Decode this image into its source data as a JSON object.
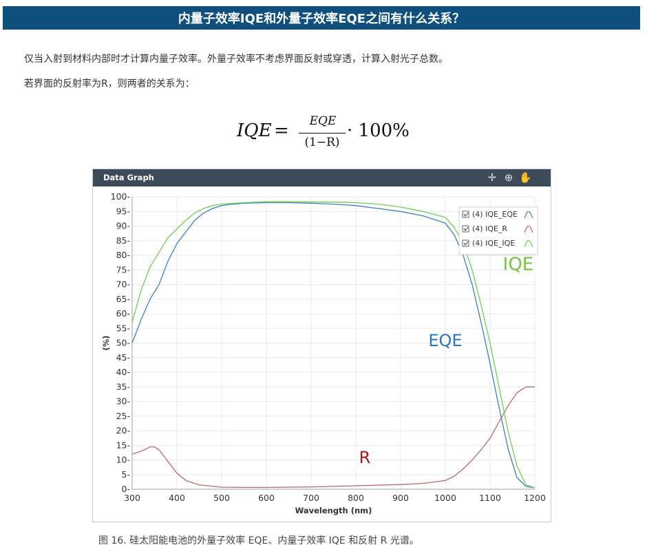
{
  "header": {
    "title": "内量子效率IQE和外量子效率EQE之间有什么关系？"
  },
  "body": {
    "paragraph1": "仅当入射到材料内部时才计算内量子效率。外量子效率不考虑界面反射或穿透，计算入射光子总数。",
    "paragraph2": "若界面的反射率为R，则两者的关系为："
  },
  "formula": {
    "lhs": "IQE",
    "equals": "=",
    "numerator": "EQE",
    "denominator": "(1−R)",
    "rhs": "· 100%"
  },
  "graph": {
    "title": "Data Graph",
    "tools": [
      {
        "name": "crosshair-icon",
        "glyph": "✛"
      },
      {
        "name": "zoom-icon",
        "glyph": "⊕"
      },
      {
        "name": "pan-hand-icon",
        "glyph": "✋"
      }
    ]
  },
  "chart_data": {
    "type": "line",
    "xlabel": "Wavelength (nm)",
    "ylabel": "(%)",
    "xlim": [
      300,
      1200
    ],
    "ylim": [
      0,
      100
    ],
    "xticks": [
      300,
      400,
      500,
      600,
      700,
      800,
      900,
      1000,
      1100,
      1200
    ],
    "yticks": [
      0,
      5,
      10,
      15,
      20,
      25,
      30,
      35,
      40,
      45,
      50,
      55,
      60,
      65,
      70,
      75,
      80,
      85,
      90,
      95,
      100
    ],
    "grid": true,
    "legend_position": "top-right",
    "series": [
      {
        "name": "(4) IQE_EQE",
        "color": "#3f7fba",
        "label": "EQE",
        "label_color": "#2a73c0",
        "x": [
          300,
          320,
          340,
          360,
          380,
          400,
          420,
          440,
          460,
          480,
          500,
          520,
          550,
          600,
          650,
          700,
          750,
          800,
          850,
          900,
          950,
          1000,
          1020,
          1040,
          1060,
          1080,
          1100,
          1120,
          1140,
          1160,
          1180,
          1200
        ],
        "y": [
          50,
          58,
          65,
          70,
          78,
          84,
          88,
          92,
          94.5,
          96,
          97,
          97.4,
          97.8,
          98,
          98,
          97.8,
          97.5,
          97,
          96,
          95,
          93.5,
          91,
          87,
          80,
          70,
          57,
          43,
          28,
          14,
          4,
          1,
          0.5
        ]
      },
      {
        "name": "(4) IQE_R",
        "color": "#b5696a",
        "label": "R",
        "label_color": "#b01818",
        "x": [
          300,
          320,
          340,
          350,
          360,
          380,
          400,
          420,
          450,
          500,
          550,
          600,
          700,
          800,
          900,
          950,
          1000,
          1020,
          1040,
          1060,
          1080,
          1100,
          1120,
          1140,
          1160,
          1180,
          1200
        ],
        "y": [
          12,
          13,
          14.5,
          14.5,
          13.5,
          9.5,
          5.5,
          3,
          1.5,
          0.7,
          0.6,
          0.6,
          0.8,
          1.2,
          1.6,
          2,
          3,
          4.5,
          7,
          10,
          13.5,
          17.5,
          23,
          28.5,
          33,
          35,
          35
        ]
      },
      {
        "name": "(4) IQE_IQE",
        "color": "#6ccf52",
        "label": "IQE",
        "label_color": "#73c43f",
        "x": [
          300,
          320,
          340,
          360,
          380,
          400,
          420,
          440,
          460,
          480,
          500,
          550,
          600,
          650,
          700,
          750,
          800,
          850,
          900,
          950,
          1000,
          1020,
          1040,
          1060,
          1080,
          1100,
          1120,
          1140,
          1160,
          1180,
          1200
        ],
        "y": [
          57,
          68,
          76,
          81,
          86,
          89,
          92,
          94.5,
          96,
          97,
          97.5,
          98,
          98.3,
          98.3,
          98.2,
          98.2,
          98,
          97.5,
          96.5,
          95,
          93,
          89.5,
          84,
          75,
          63,
          50,
          35,
          20,
          8,
          1.5,
          0.5
        ]
      }
    ]
  },
  "caption": "图 16. 硅太阳能电池的外量子效率 EQE、内量子效率 IQE 和反射 R 光谱。"
}
